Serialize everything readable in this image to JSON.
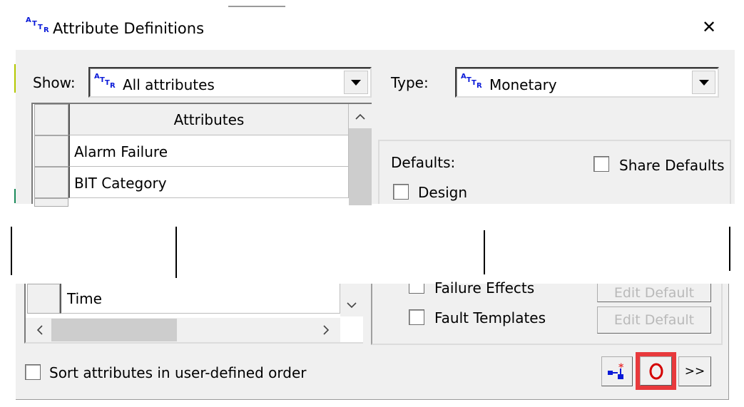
{
  "window": {
    "title": "Attribute Definitions",
    "close_glyph": "✕",
    "icon": "attribute-icon"
  },
  "show": {
    "label": "Show:",
    "value": "All attributes"
  },
  "type": {
    "label": "Type:",
    "value": "Monetary"
  },
  "attributes_table": {
    "header": "Attributes",
    "rows": [
      "Alarm Failure",
      "BIT Category"
    ],
    "last_row": "Time"
  },
  "defaults": {
    "label": "Defaults:",
    "share_label": "Share Defaults",
    "design_label": "Design",
    "failure_effects_label": "Failure Effects",
    "fault_templates_label": "Fault Templates",
    "edit_default_label": "Edit Default"
  },
  "footer": {
    "sort_label": "Sort attributes in user-defined order",
    "more_label": ">>"
  },
  "colors": {
    "accent_highlight": "#e8393c",
    "icon_blue": "#0a1ad8",
    "window_bg": "#f0f0f0"
  },
  "scroll_glyphs": {
    "up": "^",
    "down": "v",
    "left": "<",
    "right": ">"
  }
}
